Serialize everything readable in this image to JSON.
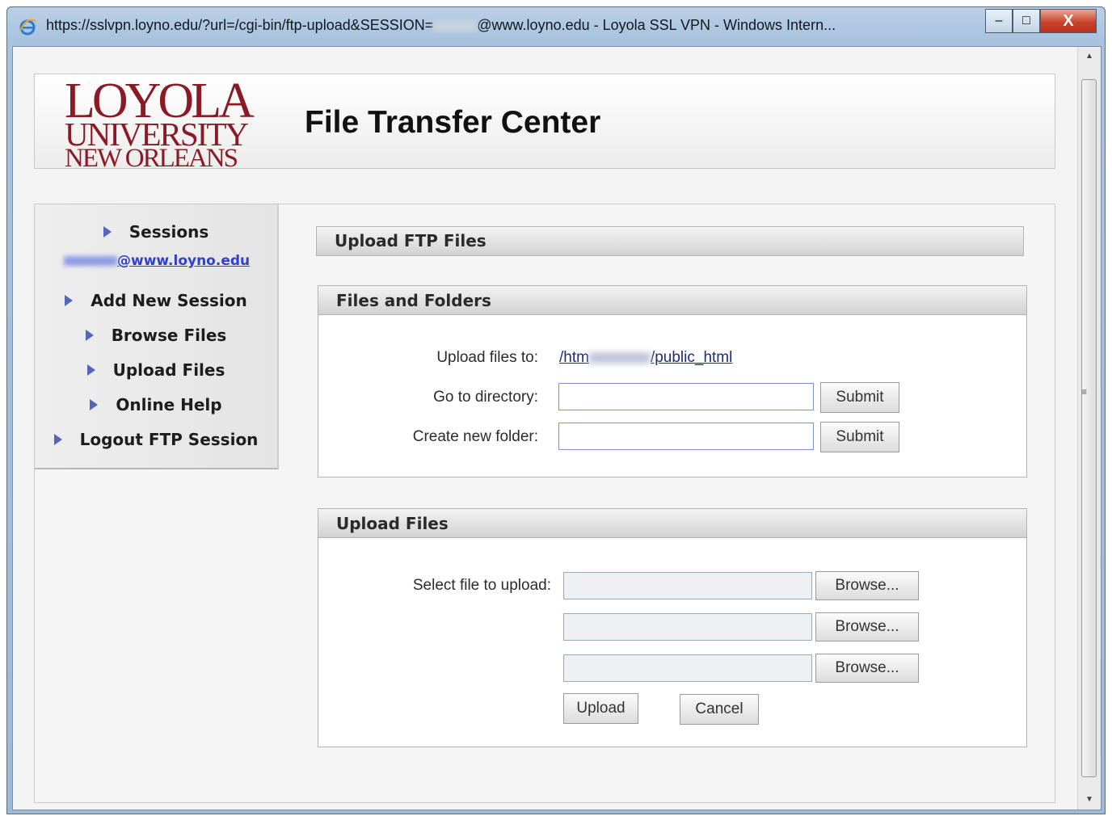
{
  "window": {
    "title_prefix": "https://sslvpn.loyno.edu/?url=/cgi-bin/ftp-upload&SESSION=",
    "title_suffix": "@www.loyno.edu - Loyola SSL VPN - Windows Intern...",
    "controls": {
      "minimize": "–",
      "maximize": "□",
      "close": "X"
    }
  },
  "header": {
    "logo": {
      "line1": "LOYOLA",
      "line2": "UNIVERSITY",
      "line3": "NEW ORLEANS",
      "color": "#8a1b26"
    },
    "title": "File Transfer Center"
  },
  "sidebar": {
    "sessions": "Sessions",
    "session_link_suffix": "@www.loyno.edu",
    "items": [
      {
        "label": "Add New Session"
      },
      {
        "label": "Browse Files"
      },
      {
        "label": "Upload Files"
      },
      {
        "label": "Online Help"
      },
      {
        "label": "Logout FTP Session"
      }
    ],
    "accent": "#5566b8"
  },
  "upload_ftp": {
    "heading": "Upload FTP Files"
  },
  "files_folders": {
    "heading": "Files and Folders",
    "upload_to_label": "Upload files to:",
    "path_prefix": "/htm",
    "path_suffix": "/public_html",
    "goto_label": "Go to directory:",
    "goto_value": "",
    "newfolder_label": "Create new folder:",
    "newfolder_value": "",
    "submit_label": "Submit"
  },
  "upload_files": {
    "heading": "Upload Files",
    "select_label": "Select file to upload:",
    "browse_label": "Browse...",
    "upload_label": "Upload",
    "cancel_label": "Cancel"
  },
  "scrollbar": {
    "grip": "≡"
  }
}
